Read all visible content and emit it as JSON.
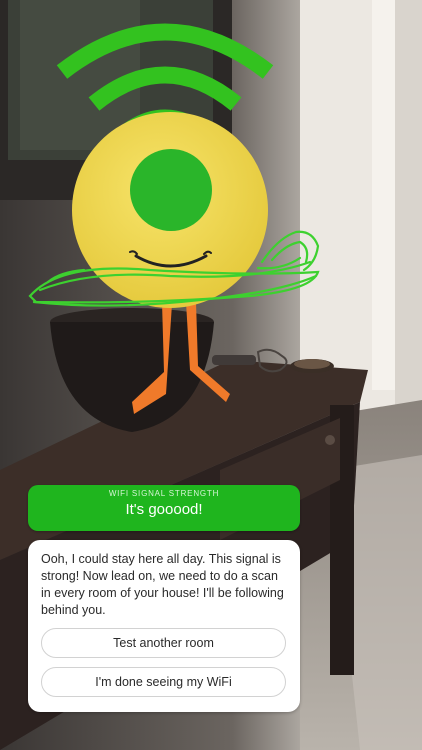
{
  "signal_panel": {
    "label": "WIFI SIGNAL STRENGTH",
    "value": "It's gooood!",
    "color": "#1fb51e"
  },
  "character": {
    "body_color": "#f0d94a",
    "eye_color": "#2ab52a",
    "legs_color": "#f07a2a",
    "wifi_icon_color": "#33c21f"
  },
  "dialog": {
    "message": "Ooh, I could stay here all day. This signal is strong! Now lead on, we need to do a scan in every room of your house! I'll be following behind you.",
    "buttons": {
      "test_another_room": "Test another room",
      "done": "I'm done seeing my WiFi"
    }
  }
}
